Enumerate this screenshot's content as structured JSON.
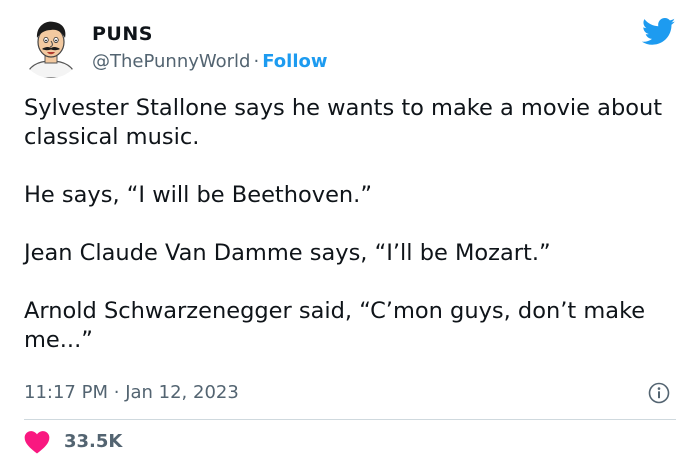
{
  "author": {
    "name": "PUNS",
    "handle": "@ThePunnyWorld",
    "separator": "·",
    "follow_label": "Follow"
  },
  "tweet": {
    "paragraphs": [
      "Sylvester Stallone says he wants to make a movie about classical music.",
      "He says, “I will be Beethoven.”",
      "Jean Claude Van Damme says, “I’ll be Mozart.”",
      "Arnold Schwarzenegger said, “C’mon guys, don’t make me...”"
    ],
    "time": "11:17 PM",
    "separator": "·",
    "date": "Jan 12, 2023"
  },
  "engagement": {
    "likes": "33.5K"
  },
  "icons": {
    "brand": "twitter-bird-icon",
    "info": "info-icon",
    "like": "heart-icon"
  },
  "colors": {
    "accent": "#1d9bf0",
    "like": "#f91880",
    "secondary_text": "#536471",
    "divider": "#cfd9de"
  }
}
